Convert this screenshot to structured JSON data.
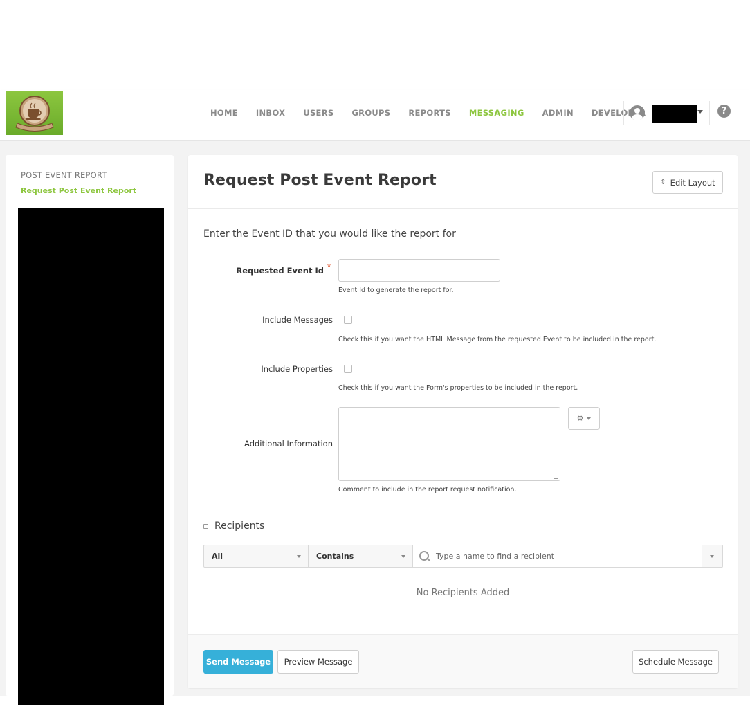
{
  "nav": {
    "items": [
      "HOME",
      "INBOX",
      "USERS",
      "GROUPS",
      "REPORTS",
      "MESSAGING",
      "ADMIN",
      "DEVELOPER"
    ],
    "active": "MESSAGING",
    "help_icon": "?"
  },
  "sidebar": {
    "heading": "POST EVENT REPORT",
    "active_link": "Request Post Event Report"
  },
  "page": {
    "title": "Request Post Event Report",
    "edit_layout_label": "Edit Layout"
  },
  "form": {
    "section_heading": "Enter the Event ID that you would like the report for",
    "event_id": {
      "label": "Requested Event Id",
      "required_mark": "*",
      "value": "",
      "help": "Event Id to generate the report for."
    },
    "include_messages": {
      "label": "Include Messages",
      "checked": false,
      "help": "Check this if you want the HTML Message from the requested Event to be included in the report."
    },
    "include_properties": {
      "label": "Include Properties",
      "checked": false,
      "help": "Check this if you want the Form's properties to be included in the report."
    },
    "additional_info": {
      "label": "Additional Information",
      "value": "",
      "help": "Comment to include in the report request notification."
    }
  },
  "recipients": {
    "heading": "Recipients",
    "filter_scope": "All",
    "filter_match": "Contains",
    "search_placeholder": "Type a name to find a recipient",
    "empty_text": "No Recipients Added"
  },
  "footer": {
    "send_label": "Send Message",
    "preview_label": "Preview Message",
    "schedule_label": "Schedule Message"
  },
  "colors": {
    "brand_green": "#8dc63f",
    "primary_button": "#36b0d9",
    "required_star": "#e0532d"
  }
}
